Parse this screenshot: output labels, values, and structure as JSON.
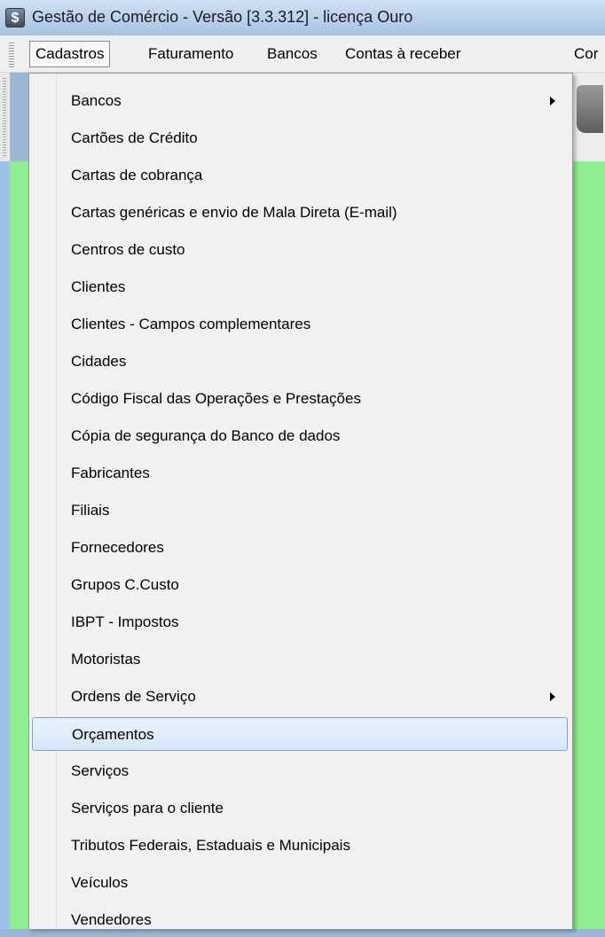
{
  "window": {
    "app_icon_glyph": "$",
    "title": "Gestão de Comércio - Versão [3.3.312] - licença Ouro"
  },
  "menubar": {
    "items": [
      {
        "label": "Cadastros"
      },
      {
        "label": "Faturamento"
      },
      {
        "label": "Bancos"
      },
      {
        "label": "Contas à receber"
      },
      {
        "label": "Cor"
      }
    ]
  },
  "dropdown": {
    "items": [
      {
        "label": "Bancos",
        "submenu": true
      },
      {
        "label": "Cartões de Crédito"
      },
      {
        "label": "Cartas de cobrança"
      },
      {
        "label": "Cartas genéricas e envio de Mala Direta  (E-mail)"
      },
      {
        "label": "Centros de custo"
      },
      {
        "label": "Clientes"
      },
      {
        "label": "Clientes - Campos complementares"
      },
      {
        "label": "Cidades"
      },
      {
        "label": "Código Fiscal das Operações e Prestações"
      },
      {
        "label": "Cópia de segurança do Banco de dados"
      },
      {
        "label": "Fabricantes"
      },
      {
        "label": "Filiais"
      },
      {
        "label": "Fornecedores"
      },
      {
        "label": "Grupos C.Custo"
      },
      {
        "label": "IBPT - Impostos"
      },
      {
        "label": "Motoristas"
      },
      {
        "label": "Ordens de Serviço",
        "submenu": true
      },
      {
        "label": "Orçamentos",
        "highlighted": true
      },
      {
        "label": "Serviços"
      },
      {
        "label": "Serviços para o cliente"
      },
      {
        "label": "Tributos Federais, Estaduais e Municipais"
      },
      {
        "label": "Veículos"
      },
      {
        "label": "Vendedores"
      }
    ]
  },
  "colors": {
    "background_green": "#90ee90",
    "highlight": "#d6e7f9",
    "highlight_border": "#7da2ce"
  },
  "icons": {
    "app": "dollar-app-icon",
    "submenu": "chevron-right-icon"
  }
}
